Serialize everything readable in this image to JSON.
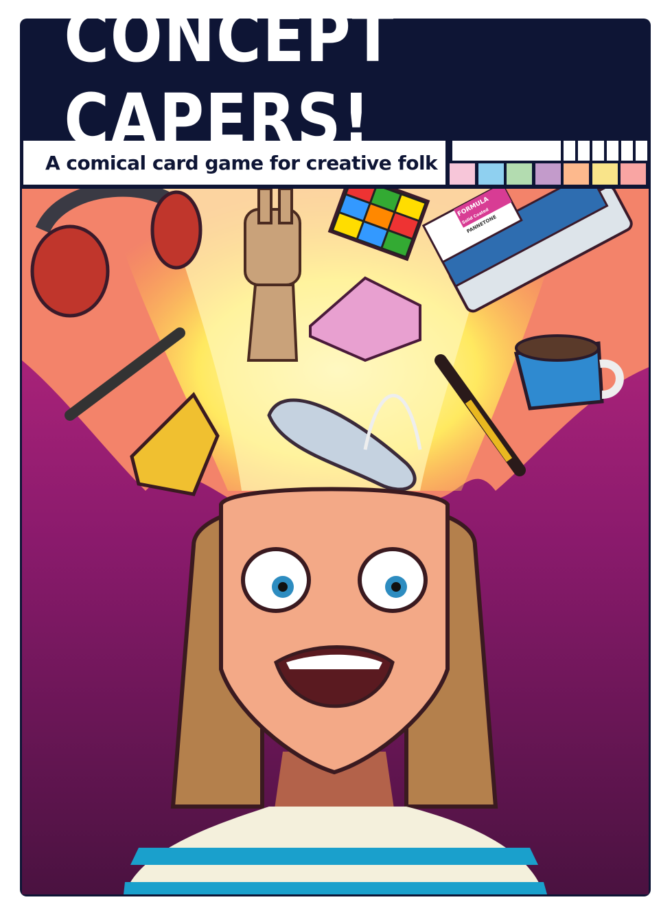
{
  "title": "CONCEPT CAPERS!",
  "subtitle": "A comical card game for creative folk",
  "swatch_colors": [
    "#f7c6d9",
    "#8fd0f0",
    "#b3dcb0",
    "#c39bcb",
    "#fdb98d",
    "#f9e48a",
    "#f9a5a3"
  ],
  "swatch_book": {
    "brand": "PANNETONE",
    "line": "FORMULA",
    "finish": "Solid Coated"
  },
  "colors": {
    "frame": "#0e1535",
    "bg_top": "#b0237a",
    "bg_bottom": "#4a1240",
    "glow": "#fff3a0"
  }
}
